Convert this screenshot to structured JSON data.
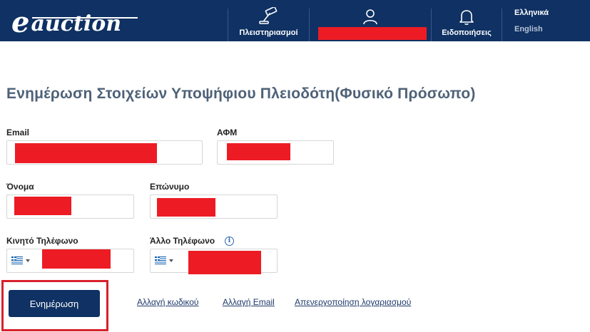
{
  "header": {
    "logo_e": "e",
    "logo_word": "auction",
    "nav": {
      "auctions_label": "Πλειστηριασμοί",
      "notifications_label": "Ειδοποιήσεις"
    },
    "languages": [
      "Ελληνικά",
      "English"
    ]
  },
  "page": {
    "title": "Ενημέρωση Στοιχείων Υποψήφιου Πλειοδότη(Φυσικό Πρόσωπο)"
  },
  "form": {
    "email_label": "Email",
    "afm_label": "ΑΦΜ",
    "first_name_label": "Όνομα",
    "last_name_label": "Επώνυμο",
    "mobile_label": "Κινητό Τηλέφωνο",
    "other_phone_label": "Άλλο Τηλέφωνο",
    "info_glyph": "i"
  },
  "actions": {
    "update_button": "Ενημέρωση",
    "change_password": "Αλλαγή κωδικού",
    "change_email": "Αλλαγή Email",
    "deactivate_account": "Απενεργοποίηση λογαριασμού"
  },
  "colors": {
    "header_bg": "#0f3163",
    "title": "#4e6278",
    "redaction": "#ed1c24",
    "highlight": "#d7212b"
  }
}
